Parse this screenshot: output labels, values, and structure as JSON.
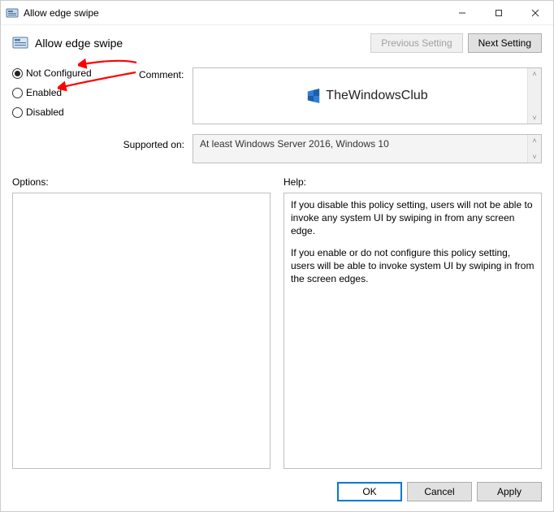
{
  "window": {
    "title": "Allow edge swipe",
    "icon_name": "policy-icon"
  },
  "header": {
    "title": "Allow edge swipe",
    "prev_label": "Previous Setting",
    "next_label": "Next Setting"
  },
  "radios": {
    "not_configured": "Not Configured",
    "enabled": "Enabled",
    "disabled": "Disabled",
    "selected": "not_configured"
  },
  "labels": {
    "comment": "Comment:",
    "supported_on": "Supported on:",
    "options": "Options:",
    "help": "Help:"
  },
  "comment": {
    "logo_text": "TheWindowsClub"
  },
  "supported_on": "At least Windows Server 2016, Windows 10",
  "help": {
    "p1": "If you disable this policy setting, users will not be able to invoke any system UI by swiping in from any screen edge.",
    "p2": "If you enable or do not configure this policy setting, users will be able to invoke system UI by swiping in from the screen edges."
  },
  "footer": {
    "ok": "OK",
    "cancel": "Cancel",
    "apply": "Apply"
  },
  "scroll_glyphs": {
    "up": "˄",
    "down": "˅"
  }
}
